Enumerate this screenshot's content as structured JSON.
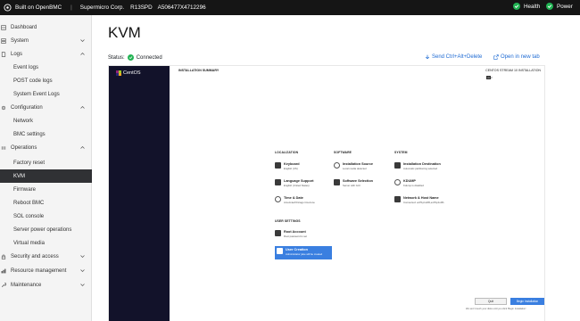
{
  "topbar": {
    "built_on": "Built on OpenBMC",
    "separator": "|",
    "corp": "Supermicro Corp.",
    "model": "R13SPD",
    "serial": "A506477X4712296",
    "health_label": "Health",
    "power_label": "Power",
    "status_color": "#21b353"
  },
  "sidebar": {
    "dashboard": "Dashboard",
    "system": "System",
    "logs": "Logs",
    "event_logs": "Event logs",
    "post_code_logs": "POST code logs",
    "system_event_logs": "System Event Logs",
    "configuration": "Configuration",
    "network": "Network",
    "bmc_settings": "BMC settings",
    "operations": "Operations",
    "factory_reset": "Factory reset",
    "kvm": "KVM",
    "firmware": "Firmware",
    "reboot_bmc": "Reboot BMC",
    "sol_console": "SOL console",
    "server_power_operations": "Server power operations",
    "virtual_media": "Virtual media",
    "security_and_access": "Security and access",
    "resource_management": "Resource management",
    "maintenance": "Maintenance"
  },
  "main": {
    "title": "KVM",
    "status_label": "Status:",
    "status_value": "Connected",
    "send_cad": "Send Ctrl+Alt+Delete",
    "open_new_tab": "Open in new tab",
    "accent": "#1d6ad3"
  },
  "installer": {
    "logo_text": "CentOS",
    "summary_title": "INSTALLATION SUMMARY",
    "release_title": "CENTOS STREAM 10 INSTALLATION",
    "kbd_badge": "us",
    "help": "Help!",
    "sections": {
      "localization": "LOCALIZATION",
      "software": "SOFTWARE",
      "system": "SYSTEM",
      "user_settings": "USER SETTINGS"
    },
    "spokes": {
      "keyboard": {
        "name": "Keyboard",
        "status": "English (US)"
      },
      "language": {
        "name": "Language Support",
        "status": "English (United States)"
      },
      "time": {
        "name": "Time & Date",
        "status": "Americas/Chicago timezone"
      },
      "source": {
        "name": "Installation Source",
        "status": "Local media detected"
      },
      "software_sel": {
        "name": "Software Selection",
        "status": "Server with GUI"
      },
      "destination": {
        "name": "Installation Destination",
        "status": "Automatic partitioning selected"
      },
      "kdump": {
        "name": "KDUMP",
        "status": "Kdump is disabled"
      },
      "network": {
        "name": "Network & Host Name",
        "status": "Connected: enP1p1s0f0,enP1p1s0f1"
      },
      "root": {
        "name": "Root Account",
        "status": "Root password is set"
      },
      "user": {
        "name": "User Creation",
        "status": "Administrator jdoe will be created"
      }
    },
    "quit": "Quit",
    "begin": "Begin Installation",
    "footnote": "We won't touch your disks until you click 'Begin Installation'."
  }
}
